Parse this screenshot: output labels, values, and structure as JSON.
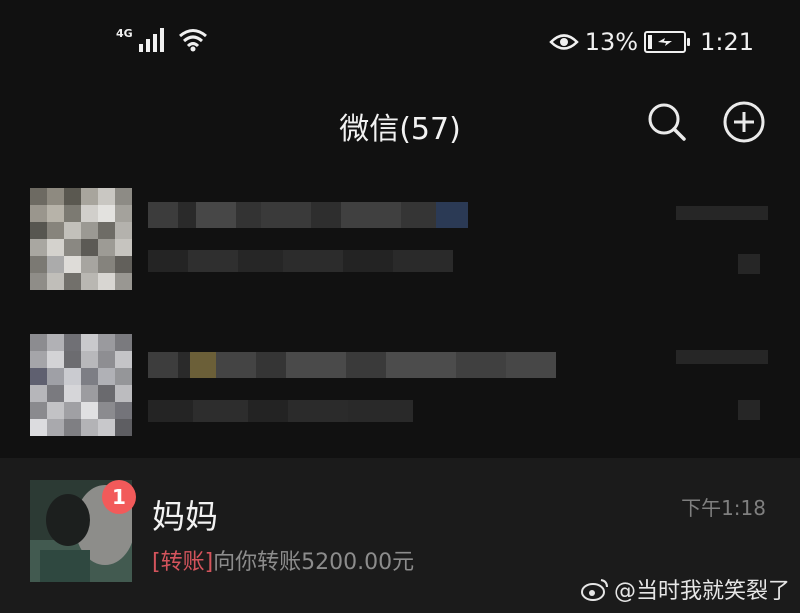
{
  "status_bar": {
    "network": "4G",
    "battery_percent": "13%",
    "battery_level": 0.13,
    "time": "1:21",
    "icons": [
      "signal-icon",
      "wifi-icon",
      "eye-comfort-icon",
      "battery-charging-icon"
    ]
  },
  "header": {
    "title": "微信(57)",
    "search_icon": "search-icon",
    "add_icon": "plus-circle-icon"
  },
  "chats": [
    {
      "name": "",
      "preview": "",
      "time": "",
      "blurred": true
    },
    {
      "name": "",
      "preview": "",
      "time": "",
      "blurred": true
    },
    {
      "name": "妈妈",
      "preview_tag": "[转账]",
      "preview": "向你转账5200.00元",
      "time": "下午1:18",
      "unread": "1",
      "blurred": false
    }
  ],
  "watermark": {
    "icon": "weibo-icon",
    "text": "@当时我就笑裂了"
  },
  "colors": {
    "background": "#111111",
    "unread_badge": "#f25a5a",
    "transfer_tag": "#d4545c"
  }
}
